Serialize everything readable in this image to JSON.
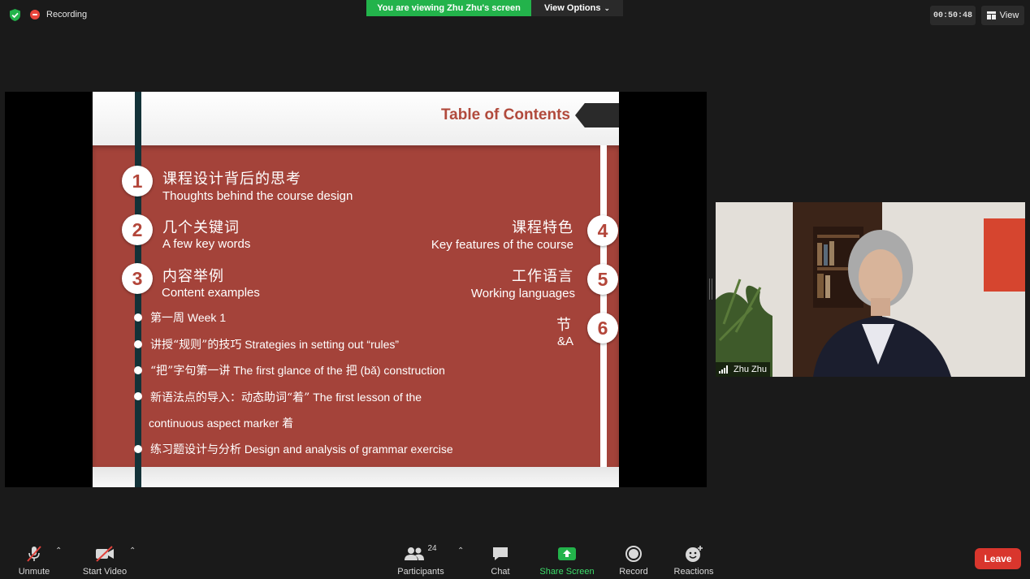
{
  "top_bar": {
    "recording_label": "Recording",
    "viewing_banner": "You are viewing Zhu Zhu's screen",
    "view_options_label": "View Options",
    "timer": "00:50:48",
    "view_label": "View"
  },
  "slide": {
    "title": "Table of Contents",
    "items": [
      {
        "number": "1",
        "zh": "课程设计背后的思考",
        "en": "Thoughts behind the course design"
      },
      {
        "number": "2",
        "zh": "几个关键词",
        "en": "A few key words"
      },
      {
        "number": "3",
        "zh": "内容举例",
        "en": "Content examples"
      },
      {
        "number": "4",
        "zh": "课程特色",
        "en": "Key features of the course"
      },
      {
        "number": "5",
        "zh": "工作语言",
        "en": "Working languages"
      },
      {
        "number": "6",
        "zh": "节",
        "en": "&A"
      }
    ],
    "bullets": [
      {
        "zh": "第一周",
        "en": " Week 1"
      },
      {
        "zh": "讲授“规则”的技巧",
        "en": " Strategies in setting out “rules”"
      },
      {
        "zh": "“把”字句第一讲",
        "en": " The first glance of the 把 (bǎ) construction"
      },
      {
        "zh": "新语法点的导入：动态助词“着”",
        "en": "  The first lesson of the"
      },
      {
        "zh": "",
        "en": "continuous aspect marker 着"
      },
      {
        "zh": "练习题设计与分析",
        "en": " Design and analysis of grammar exercise"
      }
    ]
  },
  "participant_video": {
    "name": "Zhu Zhu"
  },
  "toolbar": {
    "unmute": "Unmute",
    "start_video": "Start Video",
    "participants": "Participants",
    "participants_count": "24",
    "chat": "Chat",
    "share_screen": "Share Screen",
    "record": "Record",
    "reactions": "Reactions",
    "leave": "Leave"
  },
  "colors": {
    "share_green": "#23b34b",
    "slide_red": "#a4433a",
    "leave_red": "#d9362d",
    "recording_red": "#e8453c"
  }
}
